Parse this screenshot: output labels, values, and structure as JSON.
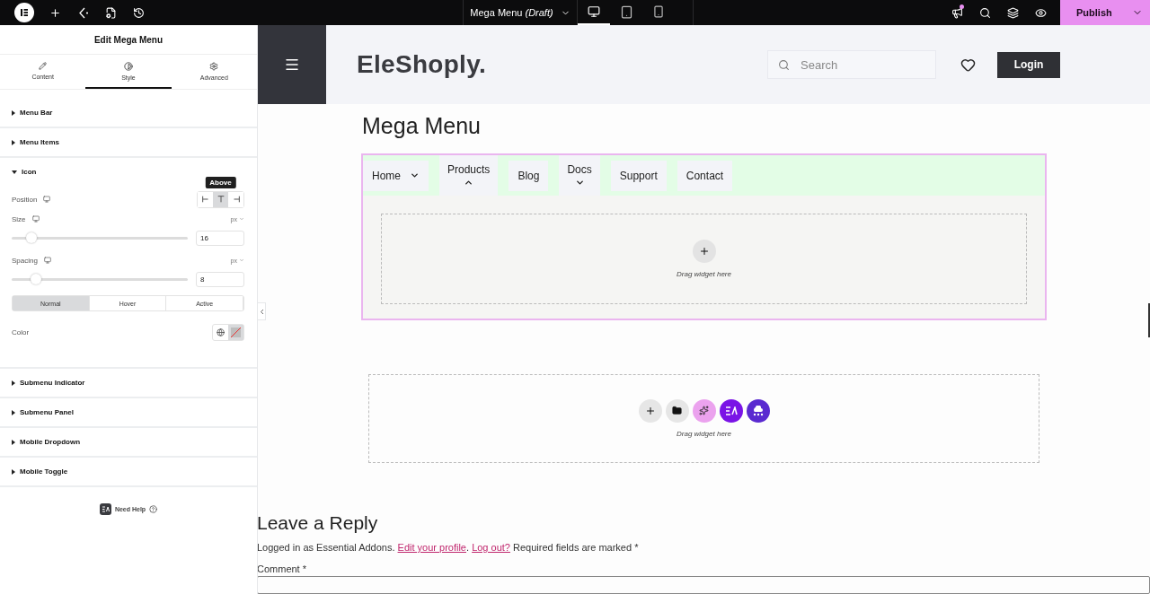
{
  "topbar": {
    "document_title": "Mega Menu",
    "document_status": "(Draft)",
    "devices": [
      {
        "kind": "desktop",
        "selected": true
      },
      {
        "kind": "tablet",
        "selected": false
      },
      {
        "kind": "mobile",
        "selected": false
      }
    ],
    "notification": true,
    "publish": "Publish"
  },
  "panel": {
    "title": "Edit Mega Menu",
    "tabs": [
      {
        "kind": "content",
        "label": "Content",
        "selected": false
      },
      {
        "kind": "style",
        "label": "Style",
        "selected": true
      },
      {
        "kind": "advanced",
        "label": "Advanced",
        "selected": false
      }
    ],
    "sections": [
      {
        "title": "Menu Bar",
        "expanded": false
      },
      {
        "title": "Menu Items",
        "expanded": false
      },
      {
        "title": "Icon",
        "expanded": true,
        "settings": {
          "position": {
            "label": "Position",
            "options": [
              {
                "kind": "left",
                "selected": false
              },
              {
                "kind": "above",
                "selected": true
              },
              {
                "kind": "right",
                "selected": false
              }
            ],
            "tooltip": "Above"
          },
          "sliders": [
            {
              "label": "Size",
              "unit": "px",
              "value": "16",
              "level": 0.11
            },
            {
              "label": "Spacing",
              "unit": "px",
              "value": "8",
              "level": 0.14
            }
          ],
          "state_tabs": [
            {
              "label": "Normal",
              "selected": true
            },
            {
              "label": "Hover",
              "selected": false
            },
            {
              "label": "Active",
              "selected": false
            }
          ],
          "color": {
            "label": "Color"
          }
        }
      },
      {
        "title": "Submenu Indicator",
        "expanded": false
      },
      {
        "title": "Submenu Panel",
        "expanded": false
      },
      {
        "title": "Mobile Dropdown",
        "expanded": false
      },
      {
        "title": "Mobile Toggle",
        "expanded": false
      }
    ],
    "help": "Need Help"
  },
  "canvas": {
    "header": {
      "logo": "EleShoply.",
      "search_placeholder": "Search",
      "login": "Login"
    },
    "heading": "Mega Menu",
    "menu_items": [
      {
        "label": "Home",
        "kind": "inline",
        "expanded": false
      },
      {
        "label": "Products",
        "kind": "stacked",
        "expanded": true
      },
      {
        "label": "Blog",
        "kind": "plain"
      },
      {
        "label": "Docs",
        "kind": "stacked",
        "expanded": false
      },
      {
        "label": "Support",
        "kind": "plain"
      },
      {
        "label": "Contact",
        "kind": "plain"
      }
    ],
    "panel_drop_hint": "Drag widget here",
    "section_actions": [
      {
        "kind": "add"
      },
      {
        "kind": "template"
      },
      {
        "kind": "ai"
      },
      {
        "kind": "addon"
      },
      {
        "kind": "cloud"
      }
    ],
    "section_drop_hint": "Drag widget here",
    "reply": {
      "title": "Leave a Reply",
      "segments": [
        {
          "kind": "text",
          "text": "Logged in as Essential Addons. "
        },
        {
          "kind": "link",
          "text": "Edit your profile"
        },
        {
          "kind": "text",
          "text": ". "
        },
        {
          "kind": "link",
          "text": "Log out?"
        },
        {
          "kind": "text",
          "text": " Required fields are marked *"
        }
      ],
      "comment_label": "Comment *"
    }
  }
}
